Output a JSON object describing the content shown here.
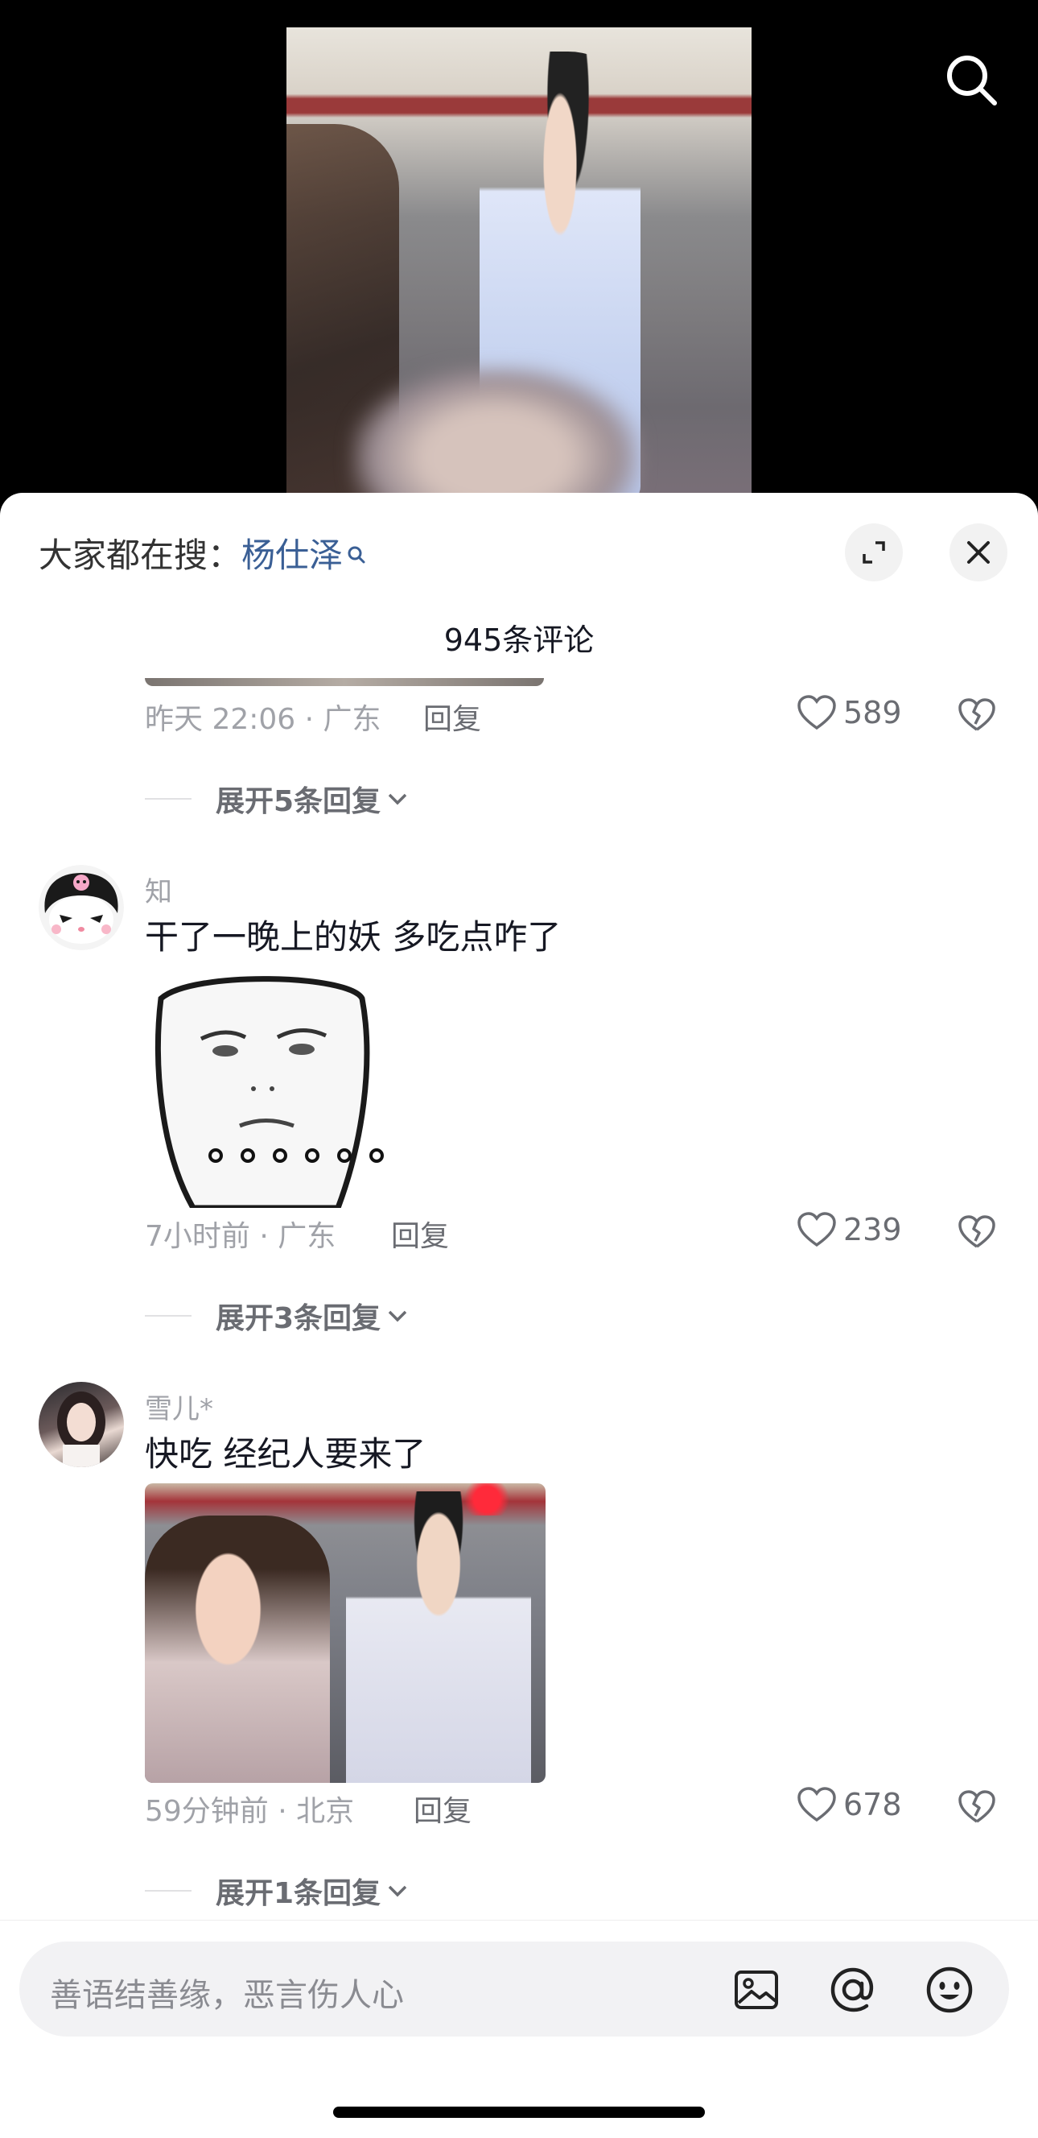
{
  "hot_search": {
    "prefix": "大家都在搜：",
    "term": "杨仕泽"
  },
  "header": {
    "comment_count": "945条评论"
  },
  "comments": [
    {
      "timestamp": "昨天 22:06 · 广东",
      "reply_label": "回复",
      "likes": "589",
      "expand_label": "展开5条回复"
    },
    {
      "username": "知",
      "text": "干了一晚上的妖 多吃点咋了",
      "timestamp": "7小时前 · 广东",
      "reply_label": "回复",
      "likes": "239",
      "expand_label": "展开3条回复"
    },
    {
      "username": "雪儿*",
      "text": "快吃 经纪人要来了",
      "timestamp": "59分钟前 · 北京",
      "reply_label": "回复",
      "likes": "678",
      "expand_label": "展开1条回复"
    }
  ],
  "input": {
    "placeholder": "善语结善缘，恶言伤人心"
  },
  "icons": {
    "search": "search-icon",
    "expand": "expand-icon",
    "close": "close-icon",
    "like": "heart-icon",
    "dislike": "broken-heart-icon",
    "image": "image-icon",
    "mention": "at-icon",
    "emoji": "emoji-icon"
  },
  "colors": {
    "hot_term": "#3a5f95",
    "muted": "#a0a2a8",
    "text": "#161823"
  }
}
